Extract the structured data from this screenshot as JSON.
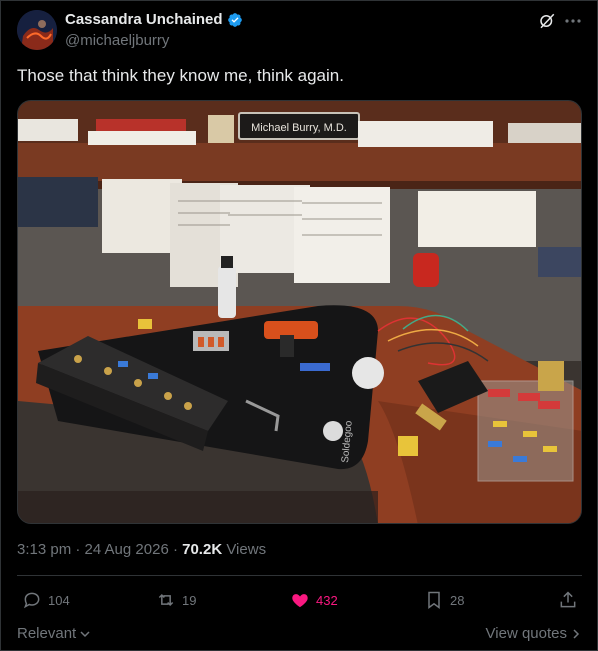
{
  "author": {
    "display_name": "Cassandra Unchained",
    "handle": "@michaeljburry",
    "verified_icon": "verified-badge-icon",
    "avatar_icon": "avatar"
  },
  "post": {
    "text": "Those that think they know me, think again.",
    "image": {
      "nameplate": "Michael Burry, M.D.",
      "mat_brand": "Soldegoo",
      "description_icon": "photo"
    },
    "timestamp": "3:13 pm · 24 Aug 2026 ·",
    "views_count": "70.2K",
    "views_label": "Views"
  },
  "actions": {
    "replies": "104",
    "reposts": "19",
    "likes": "432",
    "bookmarks": "28"
  },
  "footer": {
    "relevant": "Relevant",
    "view_quotes": "View quotes"
  },
  "colors": {
    "accent": "#1d9bf0",
    "like": "#f91880",
    "muted": "#71767b",
    "text": "#e7e9ea",
    "border": "#2f3336"
  }
}
